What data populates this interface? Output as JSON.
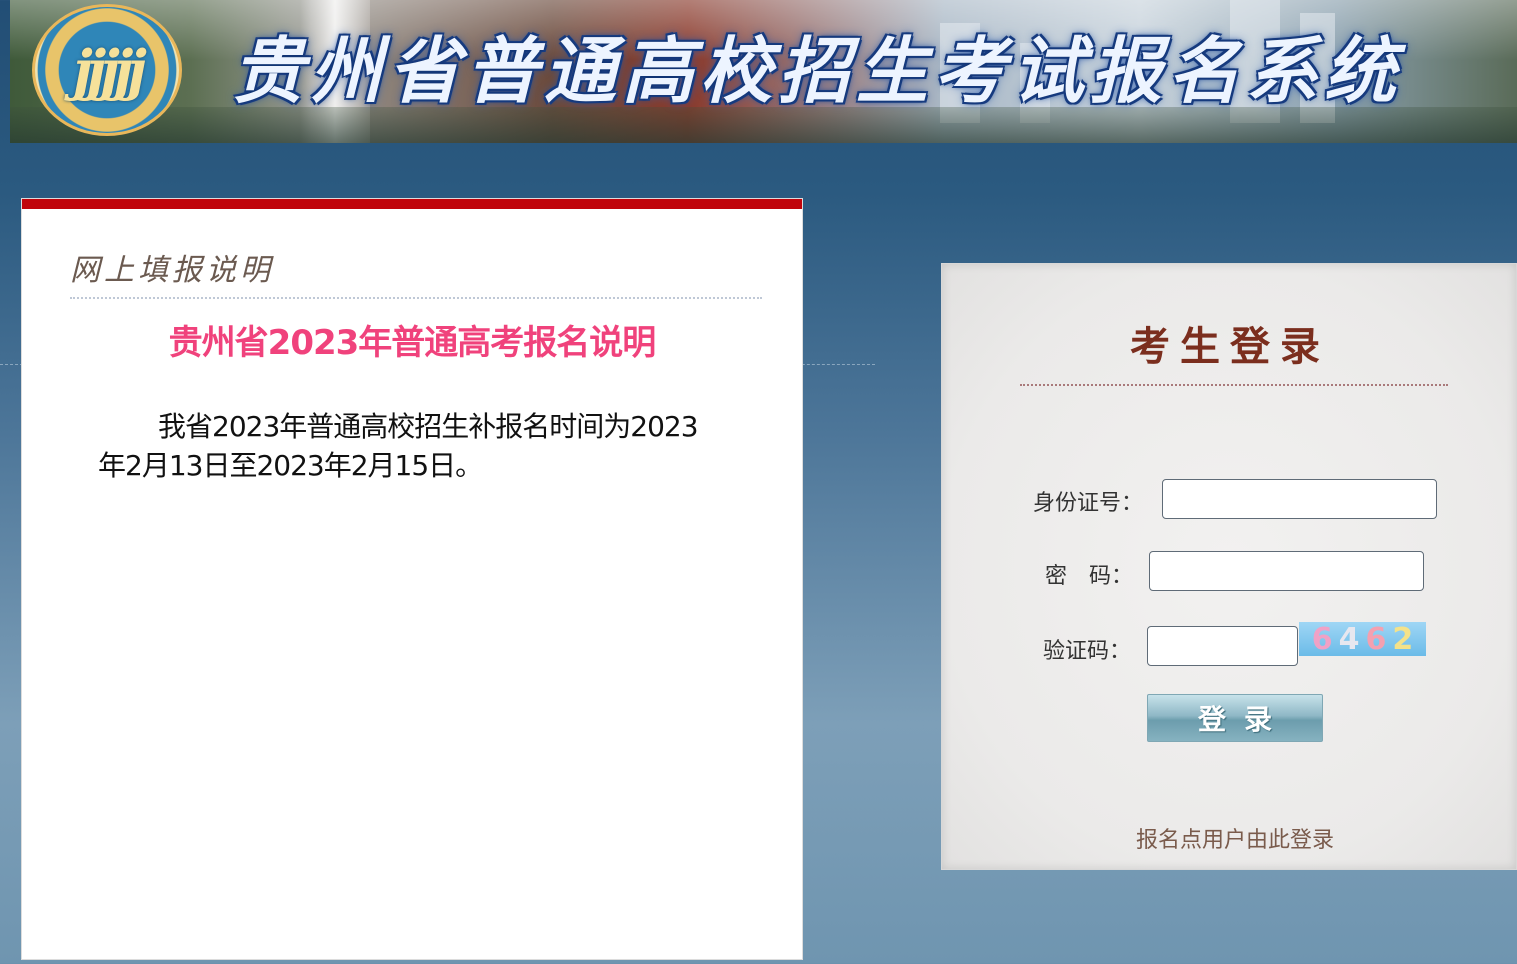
{
  "banner": {
    "title": "贵州省普通高校招生考试报名系统",
    "logo_icon": "exam-authority-logo-icon"
  },
  "info_panel": {
    "header": "网上填报说明",
    "title": "贵州省2023年普通高考报名说明",
    "body": "我省2023年普通高校招生补报名时间为2023年2月13日至2023年2月15日。"
  },
  "login": {
    "title": "考生登录",
    "id_label": "身份证号：",
    "id_value": "",
    "password_label": "密　码：",
    "password_value": "",
    "captcha_label": "验证码：",
    "captcha_value": "",
    "captcha_digits": [
      "6",
      "4",
      "6",
      "2"
    ],
    "submit_label": "登录",
    "site_user_link": "报名点用户由此登录"
  },
  "colors": {
    "accent_red": "#c0040b",
    "title_pink": "#f0427c",
    "login_title_brown": "#7b2e1e"
  }
}
